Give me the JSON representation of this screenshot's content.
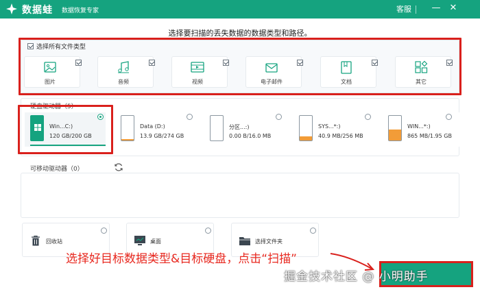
{
  "app": {
    "name": "数据蛙",
    "subtitle": "数据恢复专家",
    "support_label": "客服",
    "window_controls": [
      "minimize-icon",
      "close-icon"
    ]
  },
  "heading": "选择要扫描的丢失数据的数据类型和路径。",
  "file_types": {
    "select_all_label": "选择所有文件类型",
    "select_all_checked": true,
    "items": [
      {
        "label": "图片",
        "icon": "image-icon",
        "checked": true
      },
      {
        "label": "音频",
        "icon": "music-icon",
        "checked": true
      },
      {
        "label": "视频",
        "icon": "video-icon",
        "checked": true
      },
      {
        "label": "电子邮件",
        "icon": "email-icon",
        "checked": true
      },
      {
        "label": "文档",
        "icon": "document-icon",
        "checked": true
      },
      {
        "label": "其它",
        "icon": "other-icon",
        "checked": true
      }
    ]
  },
  "drives": {
    "title": "硬盘驱动器（5）",
    "items": [
      {
        "name": "Win...C:)",
        "size": "120 GB/200 GB",
        "selected": true,
        "fill": 0.6
      },
      {
        "name": "Data (D:)",
        "size": "13.9 GB/274 GB",
        "selected": false,
        "fill": 0.05
      },
      {
        "name": "分区...:)",
        "size": "0.00  B/16.0 MB",
        "selected": false,
        "fill": 0.0
      },
      {
        "name": "SYS...*:)",
        "size": "40.9 MB/256 MB",
        "selected": false,
        "fill": 0.16
      },
      {
        "name": "WIN...*:)",
        "size": "865 MB/1.95 GB",
        "selected": false,
        "fill": 0.44
      }
    ]
  },
  "removable": {
    "title": "可移动驱动器（0）"
  },
  "locations": [
    {
      "label": "回收站",
      "icon": "trash-icon"
    },
    {
      "label": "桌面",
      "icon": "desktop-icon"
    },
    {
      "label": "选择文件夹",
      "icon": "folder-icon"
    }
  ],
  "annotation": "选择好目标数据类型&目标硬盘，点击“扫描”",
  "watermark": "掘金技术社区 @ 小明助手",
  "colors": {
    "brand": "#15a37f",
    "annotation_red": "#d9201c",
    "drive_fill": "#f29c38"
  }
}
